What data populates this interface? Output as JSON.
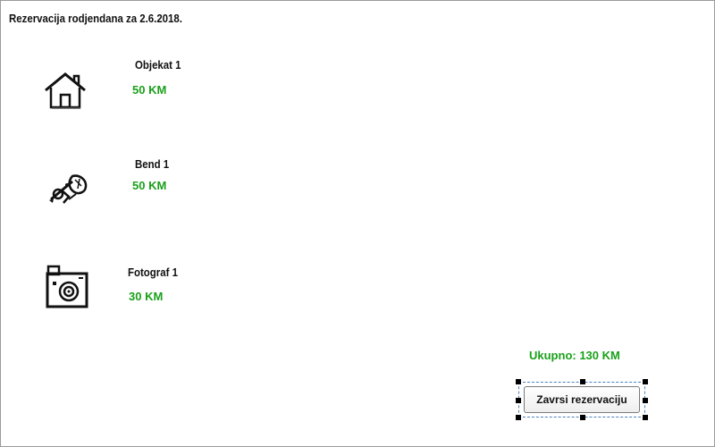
{
  "page": {
    "title": "Rezervacija rodjendana za 2.6.2018."
  },
  "items": [
    {
      "name": "Objekat 1",
      "price": "50 KM",
      "icon": "house-icon"
    },
    {
      "name": "Bend 1",
      "price": "50 KM",
      "icon": "band-instruments-icon"
    },
    {
      "name": "Fotograf 1",
      "price": "30 KM",
      "icon": "camera-icon"
    }
  ],
  "summary": {
    "total": "Ukupno: 130 KM"
  },
  "actions": {
    "finish_label": "Zavrsi rezervaciju"
  },
  "colors": {
    "price": "#1aa01a",
    "selection": "#4a7fbf"
  }
}
